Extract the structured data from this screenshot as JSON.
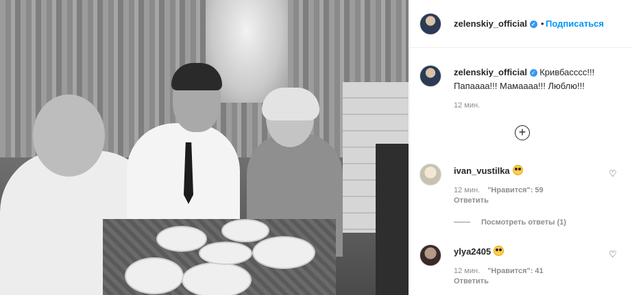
{
  "post": {
    "username": "zelenskiy_official",
    "follow_label": "Подписаться",
    "dot": "•",
    "caption": "Кривбасссс!!! Папаааа!!! Мамаааа!!! Люблю!!!",
    "time": "12 мин.",
    "add_icon": "+"
  },
  "comments": [
    {
      "username": "ivan_vustilka",
      "emoji": "heart-eyes",
      "time": "12 мин.",
      "likes": "\"Нравится\": 59",
      "reply_label": "Ответить",
      "view_replies": "Посмотреть ответы (1)"
    },
    {
      "username": "ylya2405",
      "emoji": "heart-eyes",
      "time": "12 мин.",
      "likes": "\"Нравится\": 41",
      "reply_label": "Ответить"
    }
  ],
  "colors": {
    "link": "#0095f6",
    "verified": "#3897f0",
    "muted": "#8e8e8e"
  }
}
